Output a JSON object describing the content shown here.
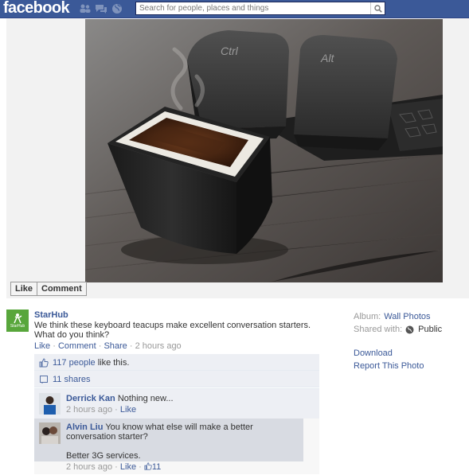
{
  "topbar": {
    "logo": "facebook",
    "search_placeholder": "Search for people, places and things",
    "jewels": [
      "friend-requests-icon",
      "messages-icon",
      "notifications-globe-icon"
    ],
    "brand_color": "#3b5998"
  },
  "photo": {
    "description_icon": "keyboard-teacup-photo",
    "key_labels": [
      "Ctrl",
      "Alt"
    ],
    "actions": {
      "like": "Like",
      "comment": "Comment"
    }
  },
  "post": {
    "author": "StarHub",
    "avatar_text": "StarHub",
    "message": "We think these keyboard teacups make excellent conversation starters. What do you think?",
    "actions": {
      "like": "Like",
      "comment": "Comment",
      "share": "Share",
      "sep": " · ",
      "time": "2 hours ago"
    },
    "likes": {
      "count_label": "117 people",
      "suffix": "like this."
    },
    "shares": {
      "label": "11 shares"
    }
  },
  "comments": [
    {
      "name": "Derrick Kan",
      "text": "Nothing new...",
      "time": "2 hours ago",
      "like": "Like"
    },
    {
      "name": "Alvin Liu",
      "text": "You know what else will make a better conversation starter?",
      "text2": "Better 3G services.",
      "time": "2 hours ago",
      "like": "Like",
      "like_count": "11"
    }
  ],
  "sidebar": {
    "album_label": "Album:",
    "album_value": "Wall Photos",
    "shared_label": "Shared with:",
    "shared_value": "Public",
    "download": "Download",
    "report": "Report This Photo"
  }
}
